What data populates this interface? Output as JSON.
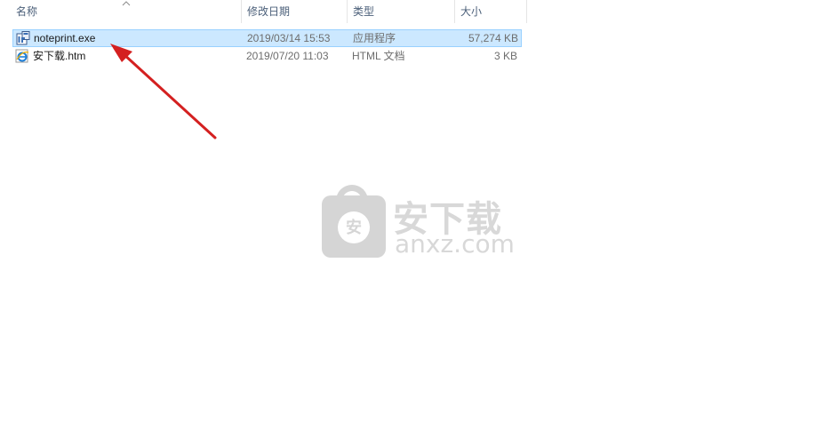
{
  "columns": {
    "name": "名称",
    "modified": "修改日期",
    "type": "类型",
    "size": "大小"
  },
  "files": [
    {
      "name": "noteprint.exe",
      "modified": "2019/03/14 15:53",
      "type": "应用程序",
      "size": "57,274 KB",
      "icon": "exe-icon",
      "selected": true
    },
    {
      "name": "安下载.htm",
      "modified": "2019/07/20 11:03",
      "type": "HTML 文档",
      "size": "3 KB",
      "icon": "ie-html-icon",
      "selected": false
    }
  ],
  "watermark": {
    "shield_char": "安",
    "cn_text": "安下载",
    "en_text": "anxz.com"
  },
  "colors": {
    "selection_bg": "#cce8ff",
    "selection_border": "#99d1ff",
    "arrow": "#d42020",
    "watermark": "#d5d5d5"
  }
}
